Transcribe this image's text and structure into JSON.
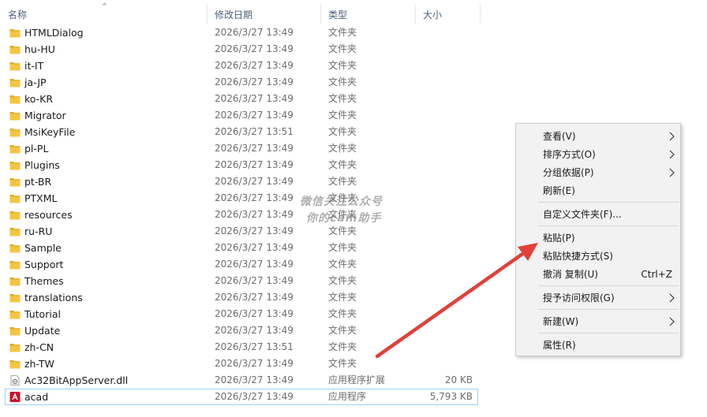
{
  "columns": {
    "name": "名称",
    "date": "修改日期",
    "type": "类型",
    "size": "大小"
  },
  "files": [
    {
      "name": "HTMLDialog",
      "date": "2026/3/27 13:49",
      "type": "文件夹",
      "size": "",
      "icon": "folder-icon"
    },
    {
      "name": "hu-HU",
      "date": "2026/3/27 13:49",
      "type": "文件夹",
      "size": "",
      "icon": "folder-icon"
    },
    {
      "name": "it-IT",
      "date": "2026/3/27 13:49",
      "type": "文件夹",
      "size": "",
      "icon": "folder-icon"
    },
    {
      "name": "ja-JP",
      "date": "2026/3/27 13:49",
      "type": "文件夹",
      "size": "",
      "icon": "folder-icon"
    },
    {
      "name": "ko-KR",
      "date": "2026/3/27 13:49",
      "type": "文件夹",
      "size": "",
      "icon": "folder-icon"
    },
    {
      "name": "Migrator",
      "date": "2026/3/27 13:49",
      "type": "文件夹",
      "size": "",
      "icon": "folder-icon"
    },
    {
      "name": "MsiKeyFile",
      "date": "2026/3/27 13:51",
      "type": "文件夹",
      "size": "",
      "icon": "folder-icon"
    },
    {
      "name": "pl-PL",
      "date": "2026/3/27 13:49",
      "type": "文件夹",
      "size": "",
      "icon": "folder-icon"
    },
    {
      "name": "Plugins",
      "date": "2026/3/27 13:49",
      "type": "文件夹",
      "size": "",
      "icon": "folder-icon"
    },
    {
      "name": "pt-BR",
      "date": "2026/3/27 13:49",
      "type": "文件夹",
      "size": "",
      "icon": "folder-icon"
    },
    {
      "name": "PTXML",
      "date": "2026/3/27 13:49",
      "type": "文件夹",
      "size": "",
      "icon": "folder-icon"
    },
    {
      "name": "resources",
      "date": "2026/3/27 13:49",
      "type": "文件夹",
      "size": "",
      "icon": "folder-icon"
    },
    {
      "name": "ru-RU",
      "date": "2026/3/27 13:49",
      "type": "文件夹",
      "size": "",
      "icon": "folder-icon"
    },
    {
      "name": "Sample",
      "date": "2026/3/27 13:49",
      "type": "文件夹",
      "size": "",
      "icon": "folder-icon"
    },
    {
      "name": "Support",
      "date": "2026/3/27 13:49",
      "type": "文件夹",
      "size": "",
      "icon": "folder-icon"
    },
    {
      "name": "Themes",
      "date": "2026/3/27 13:49",
      "type": "文件夹",
      "size": "",
      "icon": "folder-icon"
    },
    {
      "name": "translations",
      "date": "2026/3/27 13:49",
      "type": "文件夹",
      "size": "",
      "icon": "folder-icon"
    },
    {
      "name": "Tutorial",
      "date": "2026/3/27 13:49",
      "type": "文件夹",
      "size": "",
      "icon": "folder-icon"
    },
    {
      "name": "Update",
      "date": "2026/3/27 13:49",
      "type": "文件夹",
      "size": "",
      "icon": "folder-icon"
    },
    {
      "name": "zh-CN",
      "date": "2026/3/27 13:51",
      "type": "文件夹",
      "size": "",
      "icon": "folder-icon"
    },
    {
      "name": "zh-TW",
      "date": "2026/3/27 13:49",
      "type": "文件夹",
      "size": "",
      "icon": "folder-icon"
    },
    {
      "name": "Ac32BitAppServer.dll",
      "date": "2026/3/27 13:49",
      "type": "应用程序扩展",
      "size": "20 KB",
      "icon": "dll-file-icon"
    },
    {
      "name": "acad",
      "date": "2026/3/27 13:49",
      "type": "应用程序",
      "size": "5,793 KB",
      "icon": "autocad-app-icon"
    }
  ],
  "context_menu": {
    "view": "查看(V)",
    "sort_by": "排序方式(O)",
    "group_by": "分组依据(P)",
    "refresh": "刷新(E)",
    "customize_folder": "自定义文件夹(F)...",
    "paste": "粘贴(P)",
    "paste_shortcut": "粘贴快捷方式(S)",
    "undo_copy": "撤消 复制(U)",
    "undo_copy_shortcut": "Ctrl+Z",
    "give_access": "授予访问权限(G)",
    "new": "新建(W)",
    "properties": "属性(R)"
  },
  "watermark": {
    "line1": "微信关注公众号",
    "line2": "你的cam助手"
  },
  "colors": {
    "folder": "#f5c542",
    "folder_dark": "#e3ac23",
    "selection_border": "#99d1ff",
    "header_text": "#4c607a",
    "annotation_arrow": "#e2403a",
    "autocad_red": "#c8102e"
  }
}
